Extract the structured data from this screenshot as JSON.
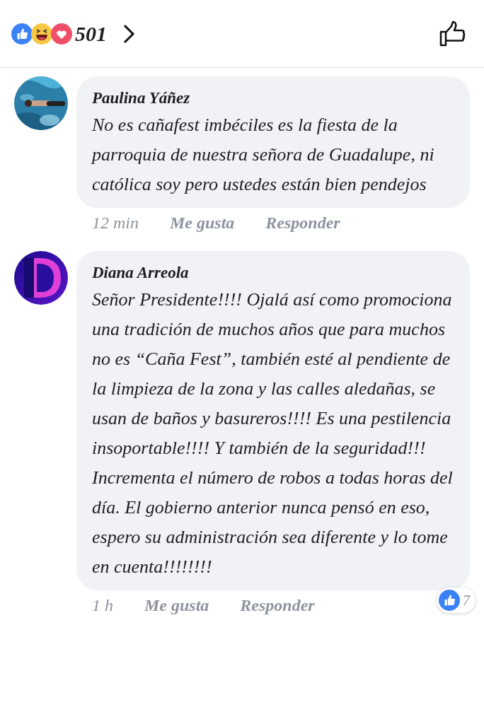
{
  "reactions": {
    "count": "501"
  },
  "comments": [
    {
      "author": "Paulina Yáñez",
      "text": "No es cañafest imbéciles es la fiesta de la parroquia de nuestra señora de Guadalupe, ni católica soy pero ustedes están bien pendejos",
      "time": "12 min",
      "like": "Me gusta",
      "reply": "Responder"
    },
    {
      "author": "Diana Arreola",
      "avatar": {
        "kind": "logo"
      },
      "text": "Señor Presidente!!!!  Ojalá así como promociona una tradición de muchos años que para muchos no es “Caña Fest”, también esté al pendiente de la limpieza de la zona y las calles aledañas, se usan de baños y basureros!!!! Es una pestilencia insoportable!!!! Y también de la seguridad!!! Incrementa el número de robos a todas horas del día. El gobierno anterior nunca pensó en eso, espero su administración sea diferente y lo tome en cuenta!!!!!!!!",
      "time": "1 h",
      "like": "Me gusta",
      "reply": "Responder",
      "reaction_count": "7"
    }
  ]
}
